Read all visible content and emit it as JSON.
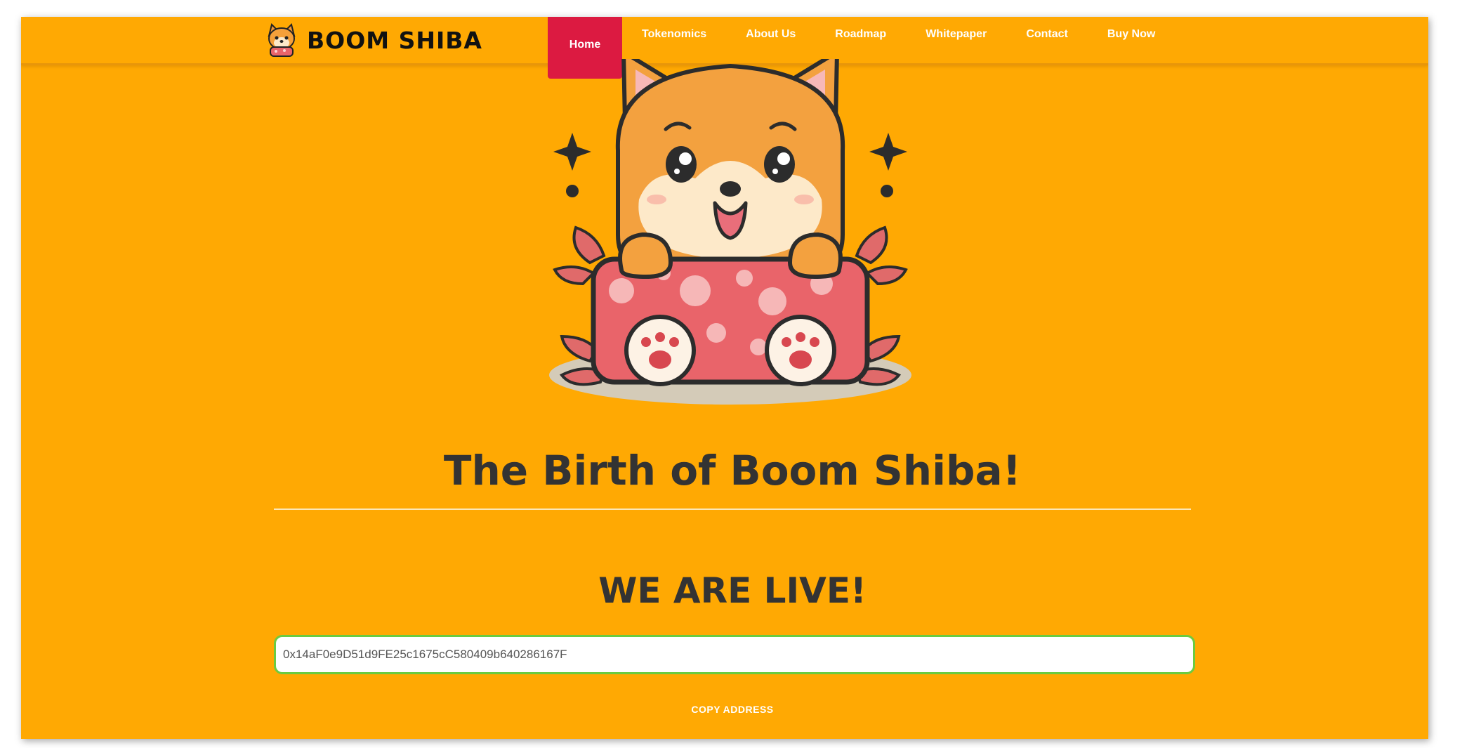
{
  "brand": {
    "name": "BOOM SHIBA",
    "logo_icon": "shiba-logo-icon"
  },
  "nav": {
    "items": [
      {
        "label": "Home",
        "active": true
      },
      {
        "label": "Tokenomics",
        "active": false
      },
      {
        "label": "About Us",
        "active": false
      },
      {
        "label": "Roadmap",
        "active": false
      },
      {
        "label": "Whitepaper",
        "active": false
      },
      {
        "label": "Contact",
        "active": false
      },
      {
        "label": "Buy Now",
        "active": false
      }
    ]
  },
  "hero": {
    "image_icon": "shiba-mascot-illustration",
    "title": "The Birth of Boom Shiba!",
    "subtitle": "WE ARE LIVE!",
    "contract_address": "0x14aF0e9D51d9FE25c1675cC580409b640286167F",
    "copy_label": "COPY ADDRESS"
  },
  "colors": {
    "background": "#FFA903",
    "nav_active": "#DC1A41",
    "heading": "#333333",
    "input_border": "#6BCB41"
  }
}
